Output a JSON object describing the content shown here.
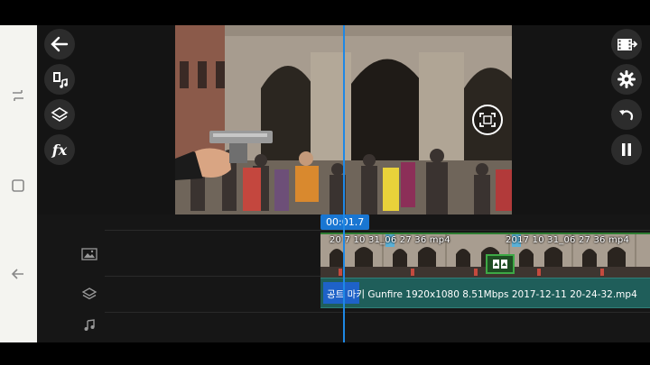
{
  "timeline": {
    "current_time": "00:01.7",
    "video_clips": [
      {
        "label": "20 7 10 31_06 27 36 mp4"
      },
      {
        "label": "2017 10 31_06 27 36 mp4"
      }
    ],
    "layer_clip": {
      "label": "공트 마키 Gunfire 1920x1080 8.51Mbps 2017-12-11 20-24-32.mp4"
    }
  },
  "colors": {
    "accent": "#1e88e5",
    "video_track_border": "#2e7d32",
    "layer_track": "#1f5e5a"
  },
  "icons": {
    "back": "arrow-left-icon",
    "media": "media-browser-icon",
    "layers": "layers-icon",
    "fx": "fx-icon",
    "export": "export-film-icon",
    "settings": "gear-icon",
    "undo": "undo-icon",
    "pause": "pause-icon",
    "crop": "crop-icon"
  },
  "fx_label": "fx"
}
